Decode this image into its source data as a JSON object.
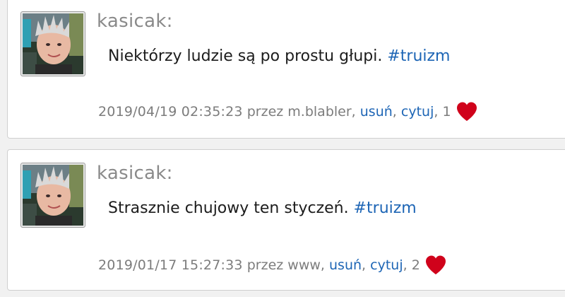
{
  "posts": [
    {
      "author": "kasicak:",
      "text": "Niektórzy ludzie są po prostu głupi.",
      "hashtag": "#truizm",
      "date": "2019/04/19 02:35:23",
      "by_prefix": "przez",
      "by_user": "m.blabler",
      "delete_label": "usuń",
      "quote_label": "cytuj",
      "likes": "1",
      "heart_icon": "heart-icon"
    },
    {
      "author": "kasicak:",
      "text": "Strasznie chujowy ten styczeń.",
      "hashtag": "#truizm",
      "date": "2019/01/17 15:27:33",
      "by_prefix": "przez",
      "by_user": "www",
      "delete_label": "usuń",
      "quote_label": "cytuj",
      "likes": "2",
      "heart_icon": "heart-icon"
    }
  ],
  "colors": {
    "link": "#1d65b5",
    "heart": "#d0021b",
    "meta_text": "#7c7c7c"
  }
}
